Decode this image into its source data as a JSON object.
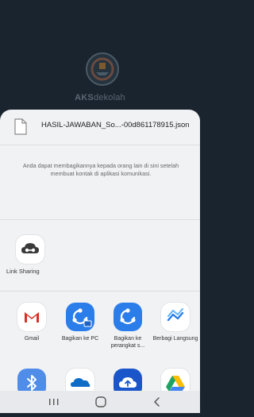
{
  "app": {
    "name_bold": "AKS",
    "name_rest": "dekolah"
  },
  "share": {
    "file_name": "HASIL-JAWABAN_So...-00d861178915.json",
    "hint": "Anda dapat membagikannya kepada orang lain di sini setelah membuat kontak di aplikasi komunikasi.",
    "link_sharing_label": "Link Sharing",
    "apps": [
      {
        "label": "Gmail",
        "icon": "gmail-icon"
      },
      {
        "label": "Bagikan ke PC",
        "icon": "bagikan-ke-pc-icon"
      },
      {
        "label": "Bagikan ke perangkat s...",
        "icon": "bagikan-ke-perangkat-icon"
      },
      {
        "label": "Berbagi Langsung",
        "icon": "berbagi-langsung-icon"
      }
    ],
    "apps_row2": [
      {
        "icon": "bluetooth-icon"
      },
      {
        "icon": "onedrive-icon"
      },
      {
        "icon": "cloud-upload-icon"
      },
      {
        "icon": "google-drive-icon"
      }
    ]
  },
  "colors": {
    "accent_blue": "#2b7de9",
    "gmail_red": "#d93025",
    "background_dark": "#19242e",
    "sheet": "#f1f2f4"
  }
}
